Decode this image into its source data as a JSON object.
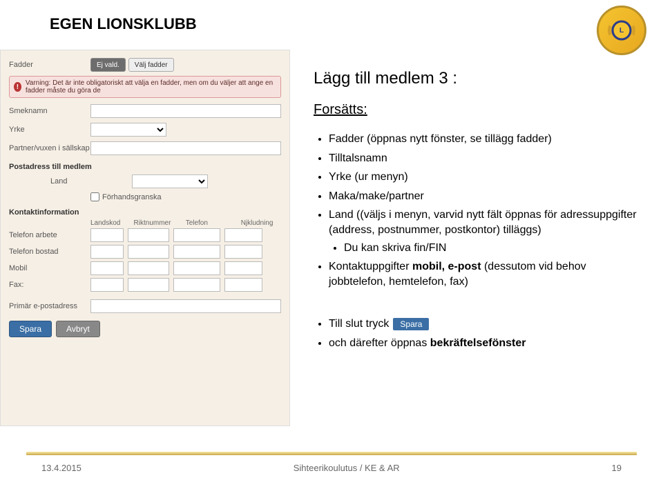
{
  "header": {
    "title": "EGEN LIONSKLUBB"
  },
  "form": {
    "fadder": {
      "label": "Fadder",
      "btn_ejvald": "Ej vald.",
      "btn_valj": "Välj fadder"
    },
    "warning": "Varning: Det är inte obligatoriskt att välja en fadder, men om du väljer att ange en fadder måste du göra de",
    "smeknamn": {
      "label": "Smeknamn"
    },
    "yrke": {
      "label": "Yrke"
    },
    "partner": {
      "label": "Partner/vuxen i sällskap"
    },
    "postadress_hdr": "Postadress till medlem",
    "land": {
      "label": "Land"
    },
    "forhand": "Förhandsgranska",
    "kontakt_hdr": "Kontaktinformation",
    "cols": {
      "landskod": "Landskod",
      "rikt": "Riktnummer",
      "tel": "Telefon",
      "njk": "Njkludning"
    },
    "tel_arbete": "Telefon arbete",
    "tel_bostad": "Telefon bostad",
    "mobil": "Mobil",
    "fax": "Fax:",
    "email": "Primär e-postadress",
    "spara": "Spara",
    "avbryt": "Avbryt"
  },
  "content": {
    "h2": "Lägg till medlem 3 :",
    "sub": "Forsätts:",
    "b1": "Fadder (öppnas nytt fönster, se tillägg fadder)",
    "b2": "Tilltalsnamn",
    "b3": "Yrke (ur menyn)",
    "b4": "Maka/make/partner",
    "b5": "Land ((väljs i menyn, varvid nytt fält öppnas för adressuppgifter (address, postnummer, postkontor) tilläggs)",
    "b5a": "Du kan skriva fin/FIN",
    "b6_pre": "Kontaktuppgifter ",
    "b6_bold": "mobil, e-post",
    "b6_post": " (dessutom vid behov jobbtelefon, hemtelefon, fax)",
    "lower1": "Till slut tryck",
    "lower1_chip": "Spara",
    "lower2_pre": "och därefter öppnas ",
    "lower2_bold": "bekräftelsefönster"
  },
  "footer": {
    "l": "13.4.2015",
    "c": "Sihteerikoulutus / KE & AR",
    "r": "19"
  }
}
